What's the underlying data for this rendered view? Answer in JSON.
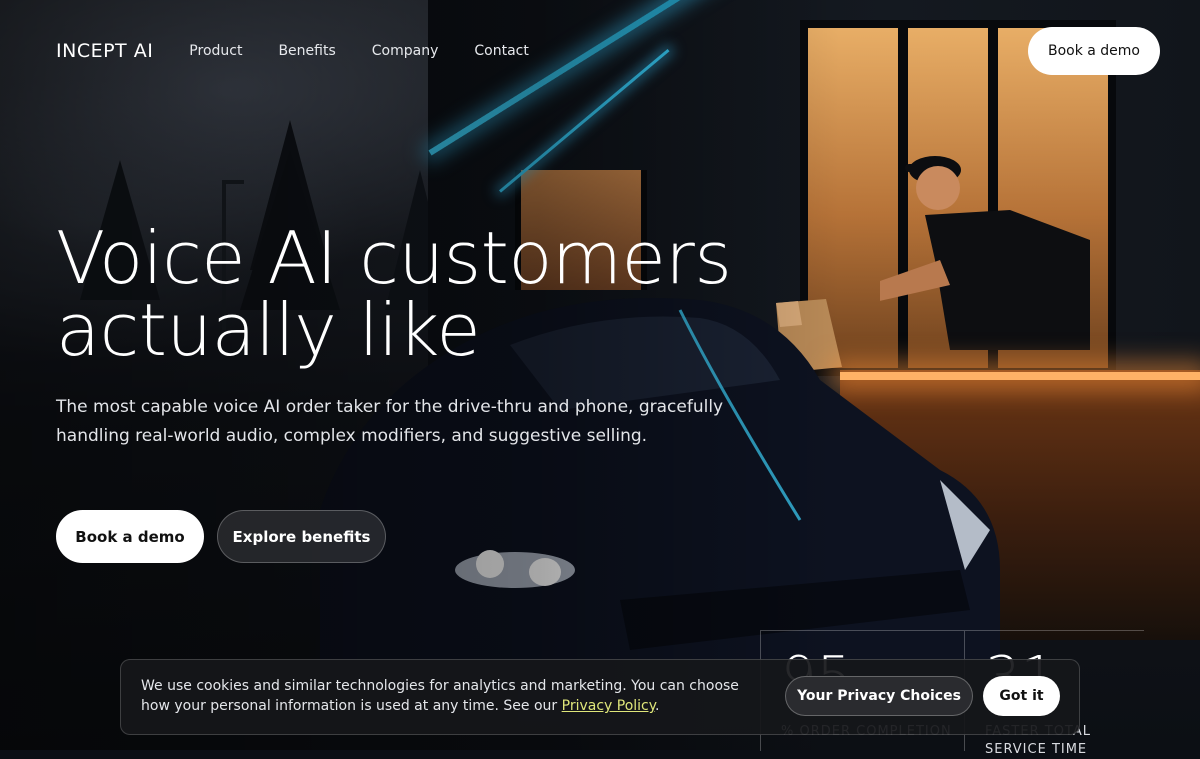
{
  "nav": {
    "logo": "INCEPT AI",
    "links": [
      "Product",
      "Benefits",
      "Company",
      "Contact"
    ],
    "cta_label": "Book a demo"
  },
  "hero": {
    "title_line1": "Voice AI customers",
    "title_line2": "actually like",
    "subtitle": "The most capable voice AI order taker for the drive-thru and phone, gracefully handling real-world audio, complex modifiers, and suggestive selling.",
    "primary_label": "Book a demo",
    "secondary_label": "Explore benefits"
  },
  "stats": [
    {
      "value": "95",
      "label": "% ORDER COMPLETION"
    },
    {
      "value": "31",
      "label": "FASTER TOTAL SERVICE TIME"
    }
  ],
  "cookie": {
    "text": "We use cookies and similar technologies for analytics and marketing. You can choose how your personal information is used at any time. See our ",
    "link_label": "Privacy Policy",
    "after_link": ".",
    "privacy_button": "Your Privacy Choices",
    "accept_button": "Got it"
  },
  "colors": {
    "accent_cyan": "#3fd6ff",
    "warm_window": "#ffb266",
    "cookie_link": "#dfe67a"
  }
}
